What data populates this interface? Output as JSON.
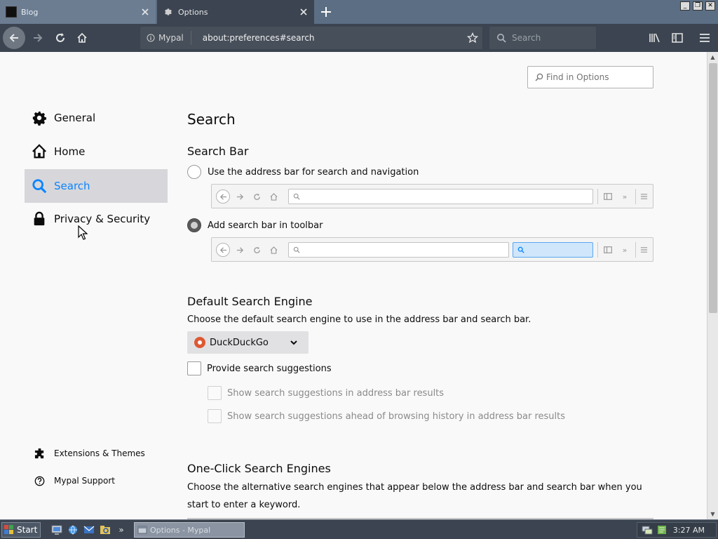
{
  "tabs": [
    {
      "title": "Blog",
      "close_icon": "close-icon"
    },
    {
      "title": "Options",
      "close_icon": "close-icon"
    }
  ],
  "navbar": {
    "identity_label": "Mypal",
    "url": "about:preferences#search",
    "search_placeholder": "Search"
  },
  "find": {
    "placeholder": "Find in Options"
  },
  "sidebar": {
    "categories": [
      {
        "label": "General",
        "icon": "gear-icon"
      },
      {
        "label": "Home",
        "icon": "home-icon"
      },
      {
        "label": "Search",
        "icon": "search-icon",
        "selected": true
      },
      {
        "label": "Privacy & Security",
        "icon": "lock-icon"
      }
    ],
    "footer": [
      {
        "label": "Extensions & Themes",
        "icon": "puzzle-icon"
      },
      {
        "label": "Mypal Support",
        "icon": "help-icon"
      }
    ]
  },
  "main": {
    "title": "Search",
    "search_bar": {
      "heading": "Search Bar",
      "option_address": "Use the address bar for search and navigation",
      "option_toolbar": "Add search bar in toolbar",
      "selected": "option_toolbar"
    },
    "default_engine": {
      "heading": "Default Search Engine",
      "description": "Choose the default search engine to use in the address bar and search bar.",
      "selected_engine": "DuckDuckGo",
      "provide_suggestions": "Provide search suggestions",
      "provide_suggestions_checked": false,
      "show_in_address_bar": "Show search suggestions in address bar results",
      "show_ahead_of_history": "Show search suggestions ahead of browsing history in address bar results"
    },
    "one_click": {
      "heading": "One-Click Search Engines",
      "description": "Choose the alternative search engines that appear below the address bar and search bar when you start to enter a keyword."
    }
  },
  "taskbar": {
    "start_label": "Start",
    "task_label": "Options - Mypal",
    "clock": "3:27 AM"
  },
  "colors": {
    "accent": "#0a84ff",
    "selected_category_bg": "#d7d7db",
    "toolbar_dark": "#3b4450"
  }
}
